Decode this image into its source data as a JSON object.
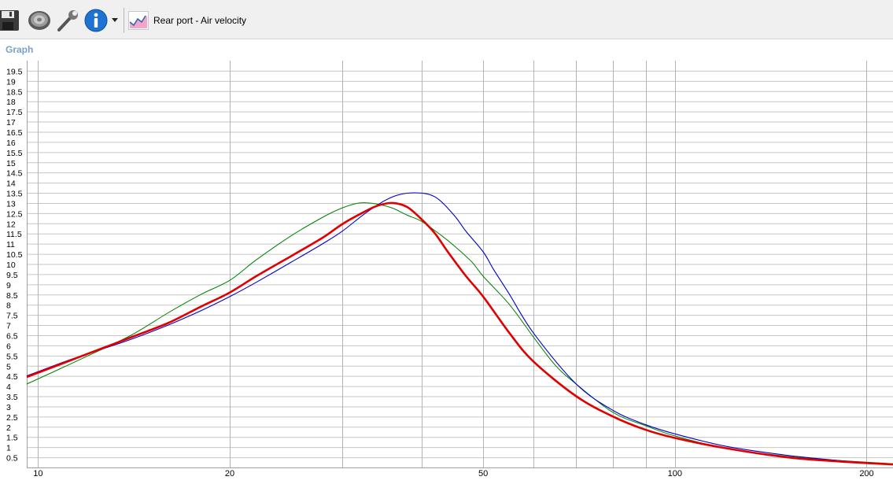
{
  "toolbar": {
    "save_icon": "floppy-disk-icon",
    "speaker_icon": "speaker-icon",
    "tools_icon": "wrench-icon",
    "info_icon": "info-icon",
    "dropdown_icon": "dropdown-arrow-icon",
    "graph_icon": "graph-icon",
    "graph_select_label": "Rear port - Air velocity"
  },
  "section": {
    "label": "Graph"
  },
  "chart_data": {
    "type": "line",
    "title": "",
    "xlabel": "",
    "ylabel": "",
    "xscale": "log",
    "xlim": [
      9.6,
      220
    ],
    "ylim": [
      0,
      20
    ],
    "grid": true,
    "x_tick_labels": [
      10,
      20,
      50,
      100,
      200
    ],
    "x_gridlines": [
      10,
      20,
      30,
      40,
      50,
      60,
      70,
      80,
      90,
      100,
      200
    ],
    "y_tick_labels": [
      "0.5",
      "1",
      "1.5",
      "2",
      "2.5",
      "3",
      "3.5",
      "4",
      "4.5",
      "5",
      "5.5",
      "6",
      "6.5",
      "7",
      "7.5",
      "8",
      "8.5",
      "9",
      "9.5",
      "10",
      "10.5",
      "11",
      "11.5",
      "12",
      "12.5",
      "13",
      "13.5",
      "14",
      "14.5",
      "15",
      "15.5",
      "16",
      "16.5",
      "17",
      "17.5",
      "18",
      "18.5",
      "19",
      "19.5"
    ],
    "series": [
      {
        "color": "#008000",
        "x": [
          9.6,
          11,
          12,
          14,
          16,
          18,
          20,
          22,
          25,
          28,
          30,
          32,
          34,
          36,
          38,
          40,
          43,
          45,
          48,
          50,
          55,
          60,
          65,
          70,
          80,
          90,
          100,
          120,
          150,
          180,
          220
        ],
        "y": [
          4.1,
          4.95,
          5.5,
          6.5,
          7.6,
          8.5,
          9.2,
          10.2,
          11.4,
          12.3,
          12.75,
          13.0,
          12.95,
          12.75,
          12.4,
          12.1,
          11.4,
          10.9,
          10.1,
          9.4,
          8.0,
          6.4,
          5.0,
          4.1,
          2.7,
          2.05,
          1.55,
          0.95,
          0.55,
          0.35,
          0.18
        ]
      },
      {
        "color": "#0000cc",
        "x": [
          9.6,
          11,
          12,
          14,
          16,
          18,
          20,
          22,
          25,
          28,
          30,
          33,
          36,
          39,
          42,
          45,
          47,
          50,
          52,
          55,
          60,
          70,
          80,
          90,
          100,
          120,
          150,
          180,
          220
        ],
        "y": [
          4.5,
          5.2,
          5.6,
          6.3,
          7.0,
          7.7,
          8.4,
          9.1,
          10.1,
          11.0,
          11.6,
          12.6,
          13.3,
          13.5,
          13.3,
          12.4,
          11.6,
          10.6,
          9.7,
          8.5,
          6.6,
          4.1,
          2.8,
          2.1,
          1.65,
          1.05,
          0.6,
          0.35,
          0.15
        ]
      },
      {
        "color": "#e00000",
        "x": [
          9.6,
          11,
          12,
          14,
          16,
          18,
          20,
          22,
          25,
          28,
          30,
          32,
          34,
          36,
          38,
          40,
          42,
          44,
          47,
          50,
          55,
          60,
          70,
          80,
          90,
          100,
          120,
          150,
          180,
          220
        ],
        "y": [
          4.45,
          5.15,
          5.6,
          6.4,
          7.1,
          7.9,
          8.6,
          9.4,
          10.4,
          11.3,
          11.95,
          12.45,
          12.85,
          13.0,
          12.8,
          12.2,
          11.5,
          10.6,
          9.4,
          8.4,
          6.6,
          5.2,
          3.5,
          2.5,
          1.85,
          1.45,
          0.95,
          0.5,
          0.3,
          0.15
        ]
      }
    ]
  }
}
